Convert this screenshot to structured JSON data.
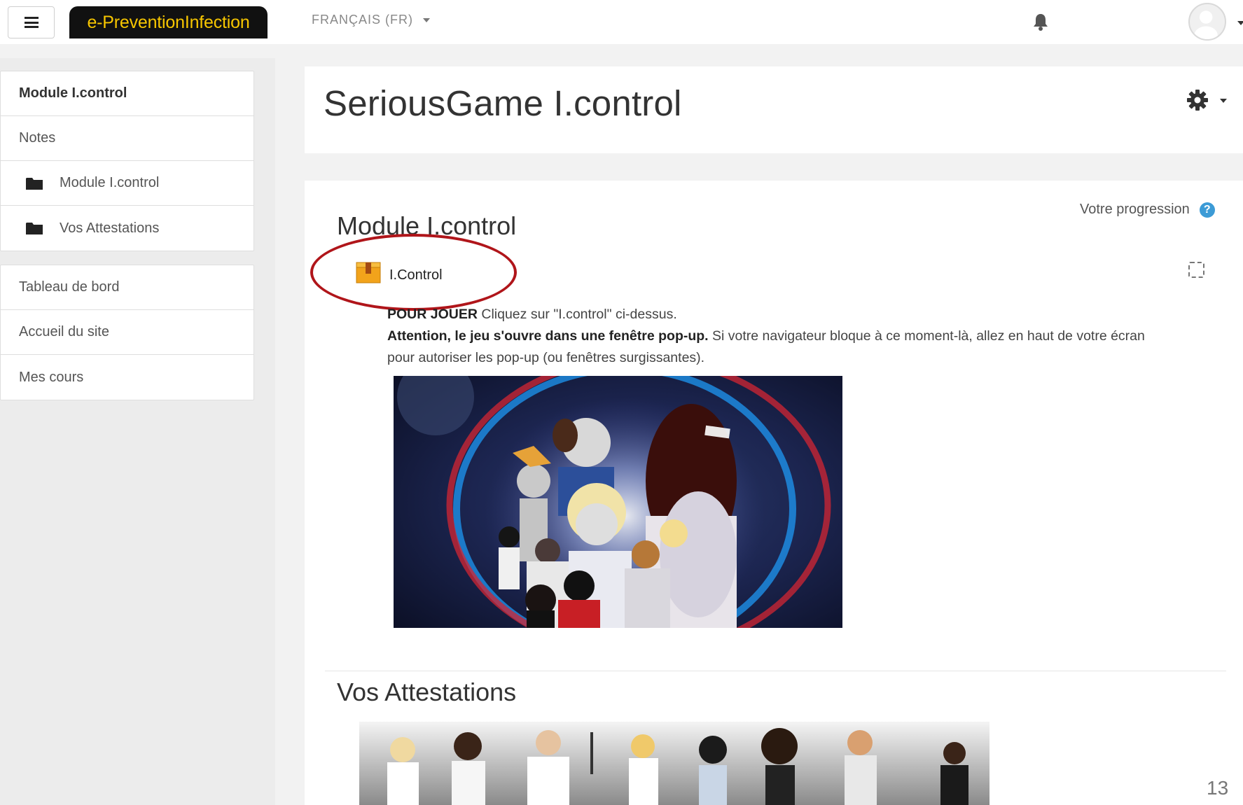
{
  "navbar": {
    "brand": "e-PreventionInfection",
    "language": "FRANÇAIS (FR)"
  },
  "sidebar": {
    "course_items": [
      {
        "label": "Module I.control",
        "active": true
      },
      {
        "label": "Notes"
      },
      {
        "label": "Module I.control",
        "icon": "folder-icon"
      },
      {
        "label": "Vos Attestations",
        "icon": "folder-icon"
      }
    ],
    "site_items": [
      {
        "label": "Tableau de bord"
      },
      {
        "label": "Accueil du site"
      },
      {
        "label": "Mes cours"
      }
    ]
  },
  "header": {
    "title": "SeriousGame I.control"
  },
  "content": {
    "progress_label": "Votre progression",
    "help_symbol": "?",
    "section1_title": "Module I.control",
    "activity_link": "I.Control",
    "desc_line1_bold": "POUR JOUER",
    "desc_line1_rest": " Cliquez sur \"I.control\" ci-dessus.",
    "desc_line2_bold": "Attention, le jeu s'ouvre dans une fenêtre pop-up.",
    "desc_line2_rest": " Si votre navigateur bloque à ce moment-là, allez en haut de votre écran pour autoriser les pop-up (ou fenêtres surgissantes).",
    "section2_title": "Vos Attestations"
  },
  "slide": {
    "page_number": "13"
  },
  "colors": {
    "brand_bg": "#111111",
    "brand_text": "#f7c600",
    "highlight_oval": "#b0151a",
    "help_icon": "#3c9bd6"
  }
}
